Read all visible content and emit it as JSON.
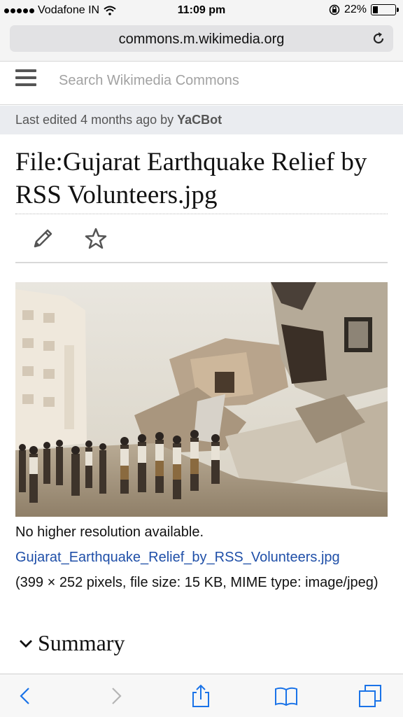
{
  "status": {
    "carrier": "Vodafone IN",
    "time": "11:09 pm",
    "battery": "22%"
  },
  "browser": {
    "url": "commons.m.wikimedia.org"
  },
  "search": {
    "placeholder": "Search Wikimedia Commons"
  },
  "last_edited": {
    "prefix": "Last edited 4 months ago by ",
    "user": "YaCBot"
  },
  "page": {
    "title": "File:Gujarat Earthquake Relief by RSS Volunteers.jpg",
    "no_higher_res": "No higher resolution available.",
    "file_link": "Gujarat_Earthquake_Relief_by_RSS_Volunteers.jpg",
    "file_info": "(399 × 252 pixels, file size: 15 KB, MIME type: image/jpeg)",
    "summary_label": "Summary"
  },
  "icons": {
    "menu": "menu-icon",
    "edit": "pencil-icon",
    "watch": "star-icon",
    "reload": "reload-icon",
    "back": "chevron-left-icon",
    "forward": "chevron-right-icon",
    "share": "share-icon",
    "bookmarks": "book-icon",
    "tabs": "tabs-icon"
  },
  "colors": {
    "link": "#1f4fa8",
    "toolbar_icon": "#1a73e8"
  }
}
